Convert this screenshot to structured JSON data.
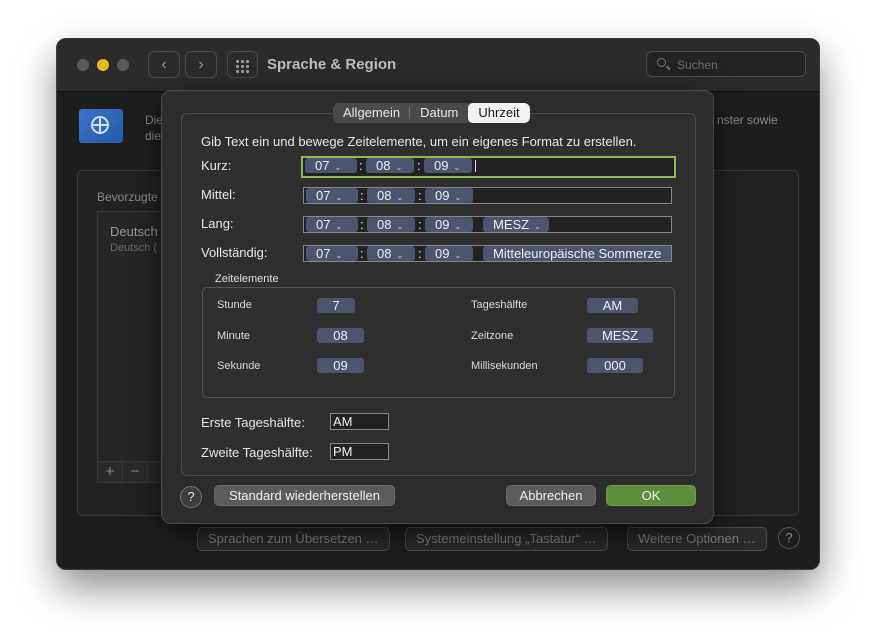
{
  "window": {
    "title": "Sprache & Region",
    "nav_back": "‹",
    "nav_forward": "›",
    "search_placeholder": "Suchen"
  },
  "background": {
    "desc_line1": "Die",
    "desc_line2": "die",
    "desc_right": "nster sowie",
    "preferred_label": "Bevorzugte",
    "list_item_title": "Deutsch",
    "list_item_sub": "Deutsch (",
    "add_label": "+",
    "remove_label": "−",
    "buttons": [
      "Sprachen zum Übersetzen …",
      "Systemeinstellung „Tastatur“ …",
      "Weitere Optionen …"
    ],
    "help": "?"
  },
  "sheet": {
    "tabs": [
      "Allgemein",
      "Datum",
      "Uhrzeit"
    ],
    "active_tab": "Uhrzeit",
    "instruction": "Gib Text ein und bewege Zeitelemente, um ein eigenes Format zu erstellen.",
    "formats": [
      {
        "label": "Kurz:",
        "tokens": [
          "07",
          "08",
          "09"
        ],
        "extra": ""
      },
      {
        "label": "Mittel:",
        "tokens": [
          "07",
          "08",
          "09"
        ],
        "extra": ""
      },
      {
        "label": "Lang:",
        "tokens": [
          "07",
          "08",
          "09"
        ],
        "extra": "MESZ"
      },
      {
        "label": "Vollständig:",
        "tokens": [
          "07",
          "08",
          "09"
        ],
        "extra": "Mitteleuropäische Sommerze"
      }
    ],
    "separator": ":",
    "elements_title": "Zeitelemente",
    "elements": {
      "hour_label": "Stunde",
      "hour_value": "7",
      "minute_label": "Minute",
      "minute_value": "08",
      "second_label": "Sekunde",
      "second_value": "09",
      "ampm_label": "Tageshälfte",
      "ampm_value": "AM",
      "tz_label": "Zeitzone",
      "tz_value": "MESZ",
      "ms_label": "Millisekunden",
      "ms_value": "000"
    },
    "first_half_label": "Erste Tageshälfte:",
    "first_half_value": "AM",
    "second_half_label": "Zweite Tageshälfte:",
    "second_half_value": "PM",
    "help": "?",
    "reset_button": "Standard wiederherstellen",
    "cancel_button": "Abbrechen",
    "ok_button": "OK"
  },
  "colors": {
    "accent_ok": "#5e8f3d",
    "focus_ring": "#8dbb5a",
    "token": "#4b5570",
    "traffic_close": "#5a5a5a",
    "traffic_min": "#e7b923",
    "traffic_max": "#5a5a5a"
  }
}
